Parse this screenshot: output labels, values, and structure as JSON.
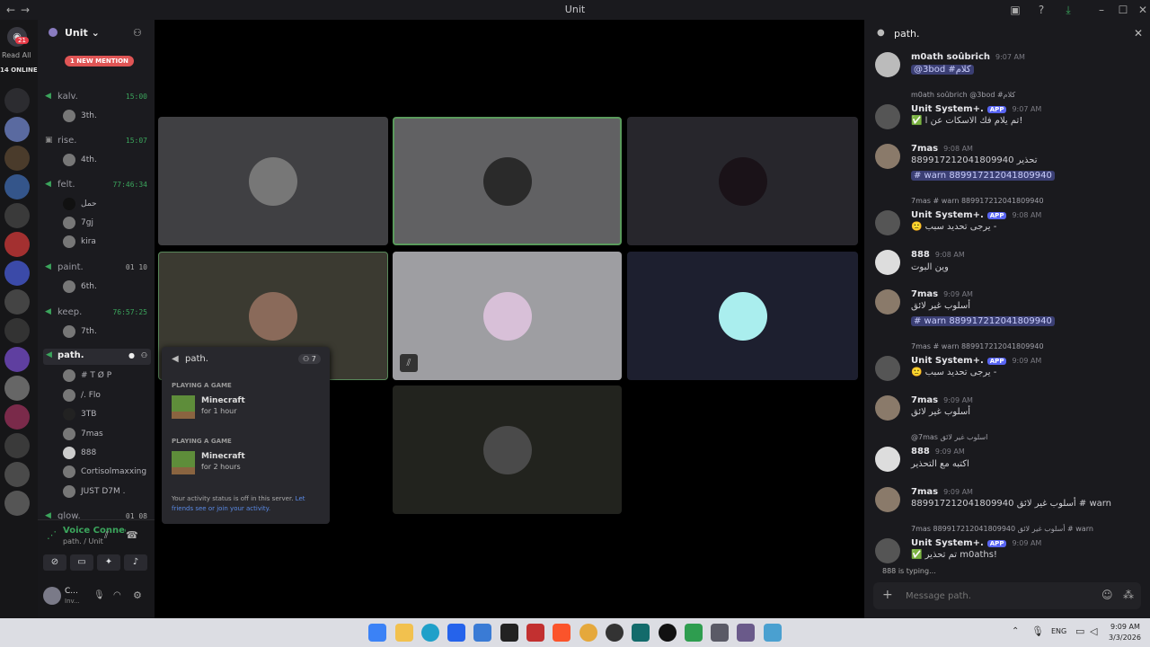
{
  "window": {
    "title": "Unit"
  },
  "servers": {
    "badge": "21",
    "read_all": "Read All",
    "online": "14 ONLINE"
  },
  "guild": {
    "name": "Unit",
    "mention": "1 NEW MENTION"
  },
  "channels": [
    {
      "name": "kalv.",
      "counter": "15:00",
      "users": [
        "3th."
      ]
    },
    {
      "name": "rise.",
      "counter": "15:07",
      "users": [
        "4th."
      ]
    },
    {
      "name": "felt.",
      "counter": "77:46:34",
      "users": [
        "حمل",
        "7gj",
        "kira"
      ]
    },
    {
      "name": "paint.",
      "counter": "01  10",
      "users": [
        "6th."
      ]
    },
    {
      "name": "keep.",
      "counter": "76:57:25",
      "users": [
        "7th."
      ]
    },
    {
      "name": "path.",
      "counter": "",
      "users": [
        "# T Ø P",
        "/. Flo",
        "3TB",
        "7mas",
        "888",
        "Cortisolmaxxing",
        "JUST D7M ."
      ]
    },
    {
      "name": "glow.",
      "counter": "01  08",
      "users": []
    }
  ],
  "voice": {
    "status": "Voice Connected",
    "location": "path. / Unit",
    "user": "C...",
    "user_sub": "Inv..."
  },
  "popup": {
    "channel": "path.",
    "count": "7",
    "games": [
      {
        "heading": "PLAYING A GAME",
        "title": "Minecraft",
        "duration": "for 1 hour"
      },
      {
        "heading": "PLAYING A GAME",
        "title": "Minecraft",
        "duration": "for 2 hours"
      }
    ],
    "note": "Your activity status is off in this server.",
    "note_link": "Let friends see or join your activity."
  },
  "chat": {
    "channel": "path.",
    "placeholder": "Message path.",
    "typing": "888 is typing...",
    "messages": [
      {
        "name": "m0ath soûbrich",
        "time": "9:07 AM",
        "text": "@3bod #كلام",
        "reply": ""
      },
      {
        "name": "Unit System+.",
        "app": "APP",
        "time": "9:07 AM",
        "text": "✅ تم يلام فك الاسكات عن ا!",
        "reply": "m0ath soûbrich @3bod #كلام"
      },
      {
        "name": "7mas",
        "time": "9:08 AM",
        "text": "889917212041809940 تحذير",
        "text2": "# warn 889917212041809940",
        "reply": ""
      },
      {
        "name": "Unit System+.",
        "app": "APP",
        "time": "9:08 AM",
        "text": "🙁 يرجى تحديد سبب -",
        "reply": "7mas # warn 889917212041809940"
      },
      {
        "name": "888",
        "time": "9:08 AM",
        "text": "وين البوت",
        "reply": ""
      },
      {
        "name": "7mas",
        "time": "9:09 AM",
        "text": "أسلوب غير لائق",
        "text2": "# warn 889917212041809940",
        "reply": ""
      },
      {
        "name": "Unit System+.",
        "app": "APP",
        "time": "9:09 AM",
        "text": "🙁 يرجى تحديد سبب -",
        "reply": "7mas # warn 889917212041809940"
      },
      {
        "name": "7mas",
        "time": "9:09 AM",
        "text": "أسلوب غير لائق",
        "reply": ""
      },
      {
        "name": "888",
        "time": "9:09 AM",
        "text": "اكتبه مع التحذير",
        "reply": "@7mas اسلوب غير لائق"
      },
      {
        "name": "7mas",
        "time": "9:09 AM",
        "text": "889917212041809940 أسلوب غير لائق # warn",
        "reply": ""
      },
      {
        "name": "Unit System+.",
        "app": "APP",
        "time": "9:09 AM",
        "text": "✅ تم تحذير m0aths!",
        "reply": "7mas 889917212041809940 أسلوب غير لائق # warn"
      }
    ]
  },
  "taskbar": {
    "lang": "ENG",
    "time": "9:09 AM",
    "date": "3/3/2026"
  }
}
